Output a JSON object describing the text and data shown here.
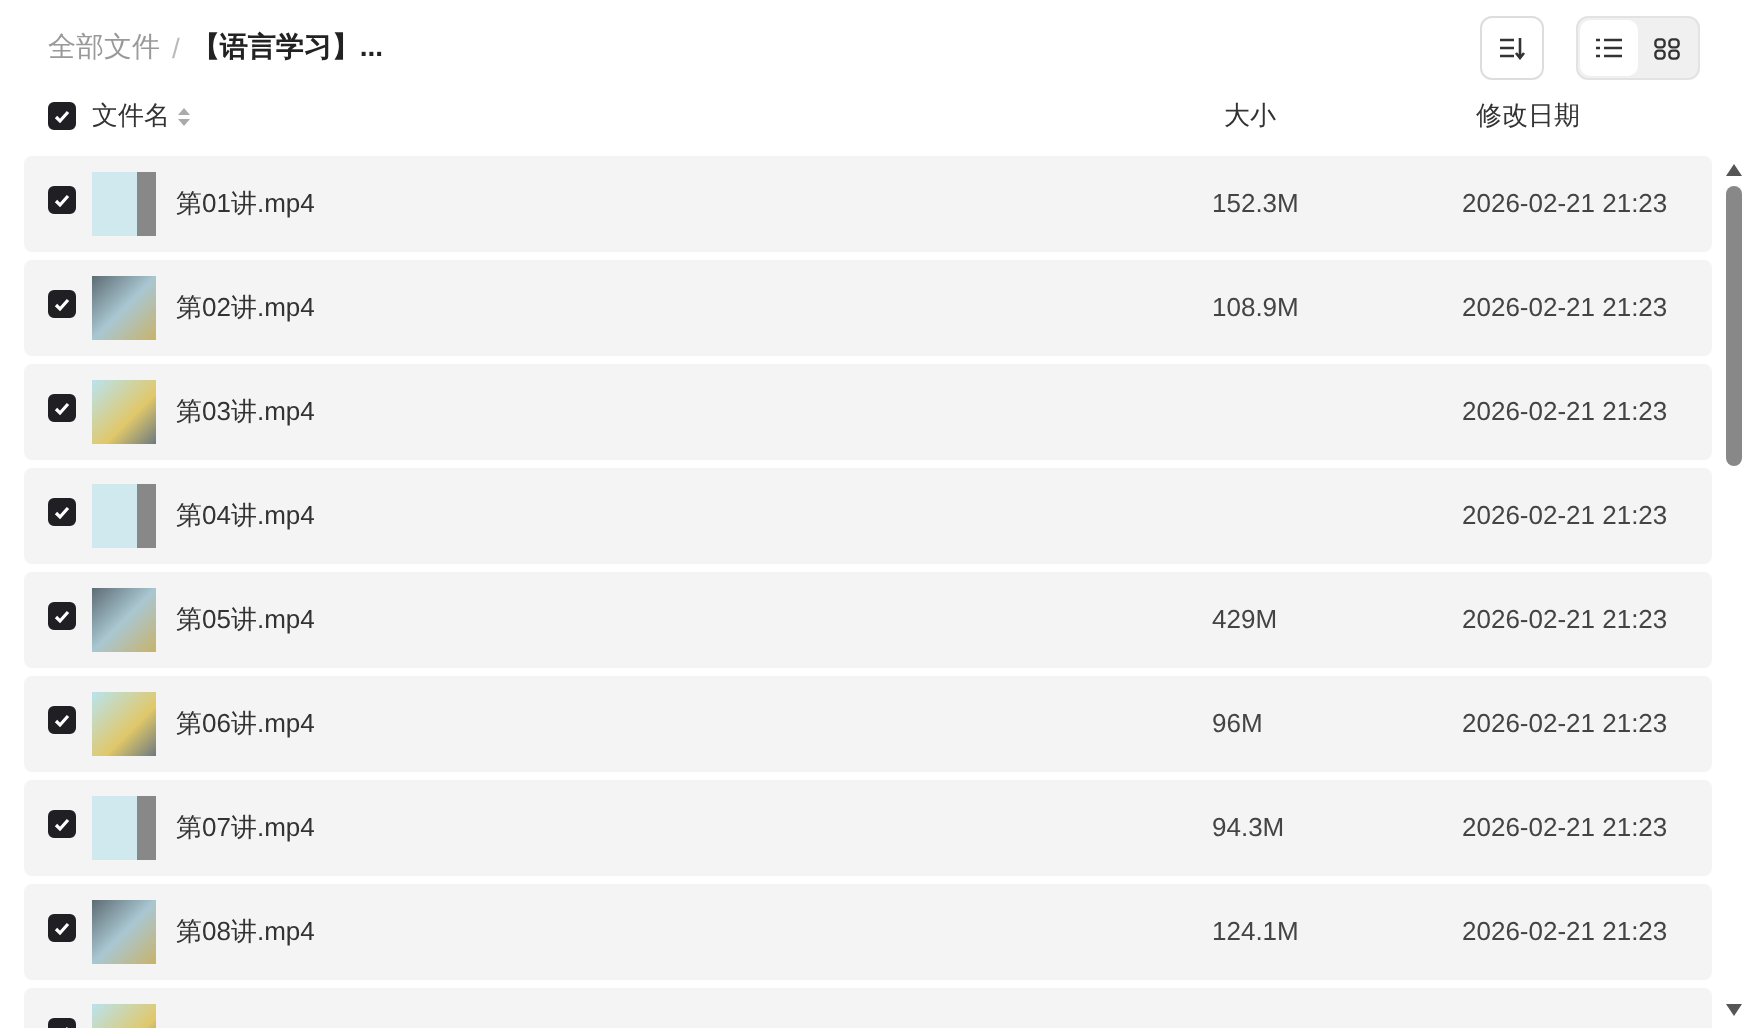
{
  "breadcrumb_separator": "/",
  "breadcrumb": [
    {
      "label": "全部文件",
      "selected": false
    },
    {
      "label": "【语言学习】...",
      "selected": true
    }
  ],
  "view_options": [
    {
      "kind": "list",
      "selected": true
    },
    {
      "kind": "grid",
      "selected": false
    }
  ],
  "header": {
    "checked": true,
    "columns": [
      "文件名",
      "大小",
      "修改日期"
    ]
  },
  "rows": [
    {
      "name": "第01讲.mp4",
      "size": "152.3M",
      "date": "2026-02-21 21:23",
      "checked": true
    },
    {
      "name": "第02讲.mp4",
      "size": "108.9M",
      "date": "2026-02-21 21:23",
      "checked": true
    },
    {
      "name": "第03讲.mp4",
      "date": "2026-02-21 21:23",
      "checked": true
    },
    {
      "name": "第04讲.mp4",
      "date": "2026-02-21 21:23",
      "checked": true
    },
    {
      "name": "第05讲.mp4",
      "size": "429M",
      "date": "2026-02-21 21:23",
      "checked": true
    },
    {
      "name": "第06讲.mp4",
      "size": "96M",
      "date": "2026-02-21 21:23",
      "checked": true
    },
    {
      "name": "第07讲.mp4",
      "size": "94.3M",
      "date": "2026-02-21 21:23",
      "checked": true
    },
    {
      "name": "第08讲.mp4",
      "size": "124.1M",
      "date": "2026-02-21 21:23",
      "checked": true
    },
    {
      "checked": true
    }
  ]
}
